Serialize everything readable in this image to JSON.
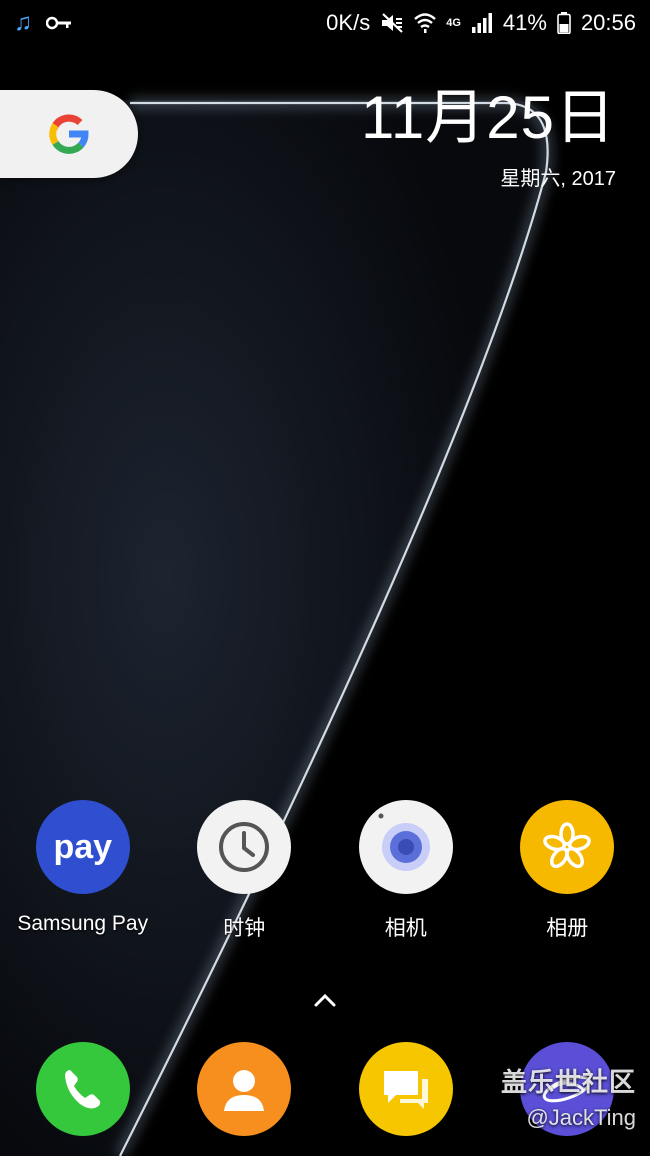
{
  "status_bar": {
    "net_speed": "0K/s",
    "network_type": "4G",
    "battery": "41%",
    "time": "20:56",
    "icons": [
      "music-icon",
      "key-icon",
      "mute-icon",
      "wifi-icon",
      "signal-icon",
      "battery-icon"
    ]
  },
  "google_widget": {
    "letter": "G"
  },
  "clock_widget": {
    "date": "11月25日",
    "weekday_year": "星期六, 2017"
  },
  "apps": [
    {
      "label": "Samsung Pay",
      "icon": "samsung-pay-icon",
      "icon_text": "pay",
      "color": "#2f4fd0"
    },
    {
      "label": "时钟",
      "icon": "clock-icon",
      "color": "#f2f2f2"
    },
    {
      "label": "相机",
      "icon": "camera-icon",
      "color": "#f2f2f2"
    },
    {
      "label": "相册",
      "icon": "gallery-icon",
      "color": "#f7b800"
    }
  ],
  "dock": [
    {
      "icon": "phone-icon",
      "color": "#35c83d"
    },
    {
      "icon": "contacts-icon",
      "color": "#f78f1e"
    },
    {
      "icon": "messages-icon",
      "color": "#f6c700"
    },
    {
      "icon": "internet-icon",
      "color": "#5a4fd6"
    }
  ],
  "watermark": {
    "line1": "盖乐世社区",
    "line2": "@JackTing"
  }
}
